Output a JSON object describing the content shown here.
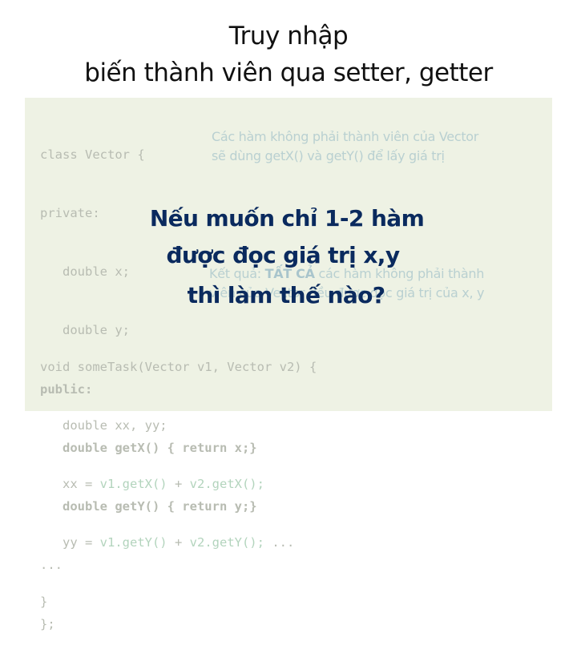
{
  "slide": {
    "title_line1": "Truy nhập",
    "title_line2": "biến thành viên qua setter, getter",
    "code_top": [
      "class Vector {",
      "private:",
      "   double x;",
      "   double y;",
      "public:",
      "   double getX() { return x;}",
      "   double getY() { return y;}",
      "...",
      "};"
    ],
    "note_top": {
      "line1": "Các hàm không phải thành viên của Vector",
      "line2": "sẽ dùng getX() và getY() để lấy giá trị"
    },
    "note_result": {
      "prefix": "Kết quả: ",
      "emphasis": "TẤT CẢ",
      "line1_rest": " các hàm không phải thành",
      "line2": "viên của Vector đều được đọc giá trị của x, y"
    },
    "question": {
      "line1": "Nếu muốn chỉ 1-2 hàm",
      "line2": "được đọc giá trị x,y",
      "line3": "thì làm thế nào?"
    },
    "code_bottom": {
      "line1": "void someTask(Vector v1, Vector v2) {",
      "line2": "   double xx, yy;",
      "line3_lhs": "   xx = ",
      "line3_a": "v1.getX()",
      "line3_op": " + ",
      "line3_b": "v2.getX();",
      "line4_lhs": "   yy = ",
      "line4_a": "v1.getY()",
      "line4_op": " + ",
      "line4_b": "v2.getY();",
      "line4_tail": " ...",
      "line5": "}"
    }
  },
  "colors": {
    "panel_bg": "#eef2e4",
    "code_text": "#b8bcb2",
    "code_highlight": "#b3d4bd",
    "note_text": "#b9d0d1",
    "question_text": "#0a2a5e"
  }
}
